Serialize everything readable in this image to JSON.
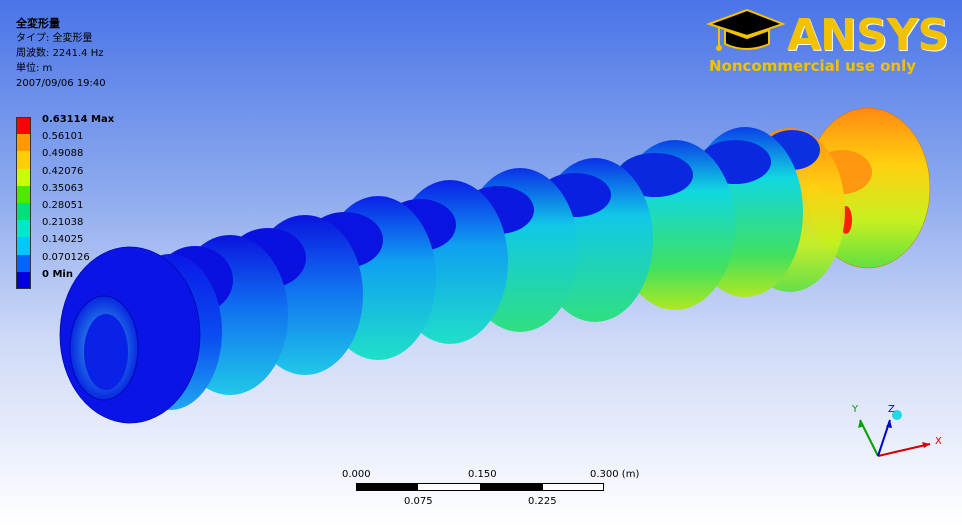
{
  "info": {
    "title": "全変形量",
    "type_line": "タイプ: 全変形量",
    "freq_line": "周波数: 2241.4 Hz",
    "unit_line": "単位: m",
    "date_line": "2007/09/06 19:40"
  },
  "legend": [
    {
      "label": "0.63114 Max",
      "color": "#ff0000",
      "bold": true
    },
    {
      "label": "0.56101",
      "color": "#ff9a00",
      "bold": false
    },
    {
      "label": "0.49088",
      "color": "#ffcf00",
      "bold": false
    },
    {
      "label": "0.42076",
      "color": "#c8ff00",
      "bold": false
    },
    {
      "label": "0.35063",
      "color": "#4fe800",
      "bold": false
    },
    {
      "label": "0.28051",
      "color": "#00e07a",
      "bold": false
    },
    {
      "label": "0.21038",
      "color": "#00e8c8",
      "bold": false
    },
    {
      "label": "0.14025",
      "color": "#00c8ff",
      "bold": false
    },
    {
      "label": "0.070126",
      "color": "#0064ff",
      "bold": false
    },
    {
      "label": "0 Min",
      "color": "#0000e0",
      "bold": true
    }
  ],
  "logo": {
    "brand": "ANSYS",
    "notice": "Noncommercial use only"
  },
  "scale_bar": {
    "top_labels": [
      "0.000",
      "0.150",
      "0.300 (m)"
    ],
    "bottom_labels": [
      "0.075",
      "0.225"
    ]
  },
  "triad": {
    "x_label": "X",
    "y_label": "Y",
    "z_label": "Z"
  }
}
